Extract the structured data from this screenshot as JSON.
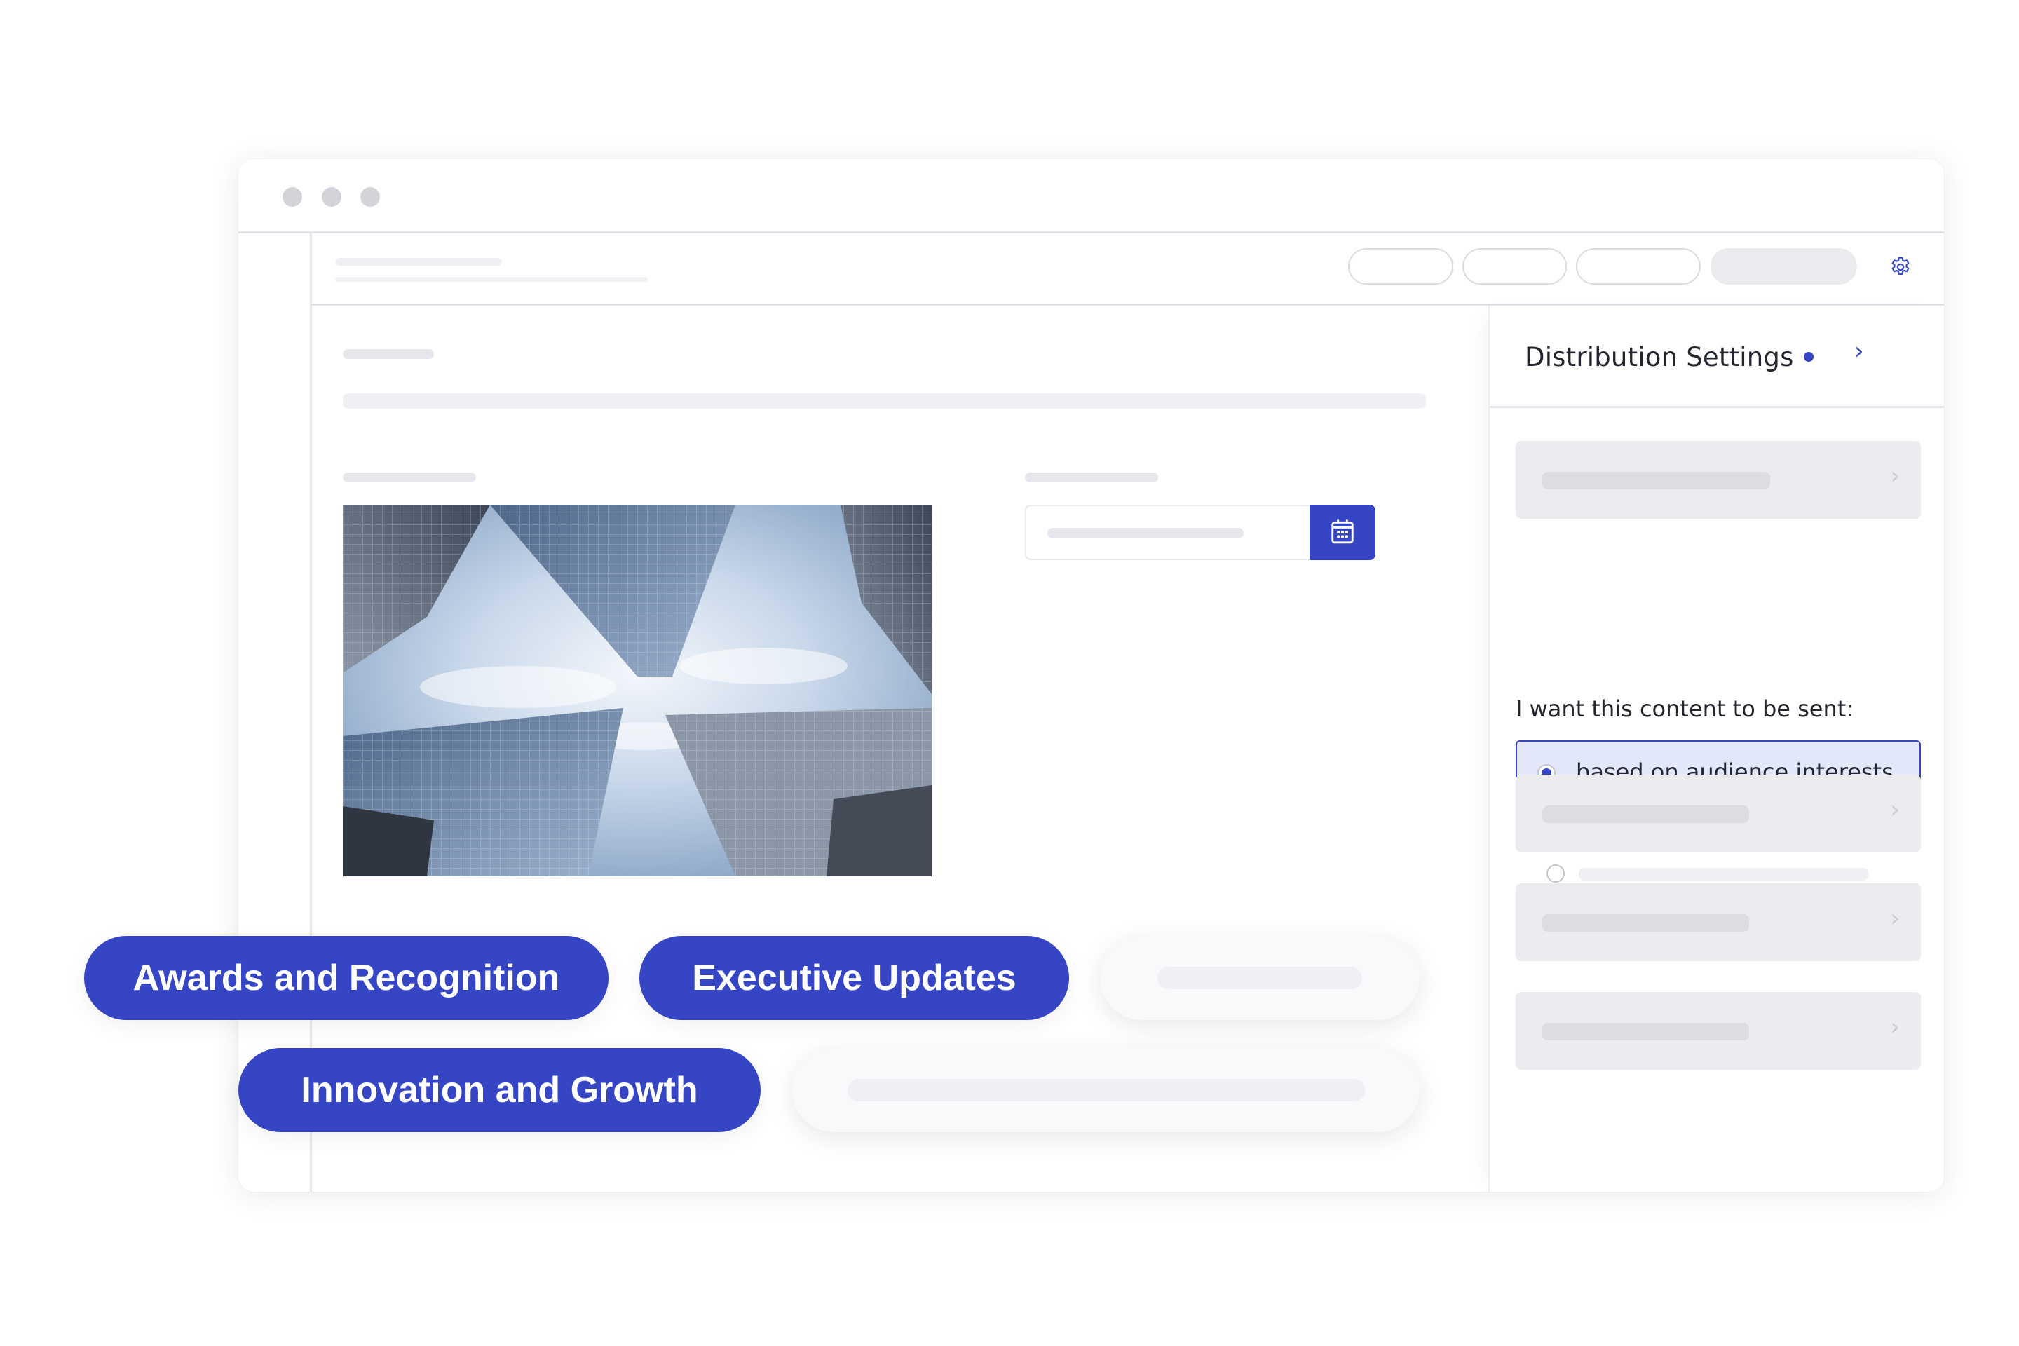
{
  "window": {
    "controls": [
      "window-dot",
      "window-dot",
      "window-dot"
    ]
  },
  "header": {
    "buttons": [
      {
        "label": "",
        "style": "outline"
      },
      {
        "label": "",
        "style": "outline"
      },
      {
        "label": "",
        "style": "outline"
      },
      {
        "label": "",
        "style": "filled"
      }
    ],
    "settings_icon": "gear-icon"
  },
  "panel": {
    "title": "Distribution Settings",
    "chevron": "›",
    "accordion_chevron": "›",
    "question": "I want this content to be sent:",
    "options": [
      {
        "label": "based on audience interests",
        "selected": true
      },
      {
        "label": "",
        "selected": false
      },
      {
        "label": "",
        "selected": false
      }
    ]
  },
  "main": {
    "date_button_icon": "calendar-icon"
  },
  "tags": [
    {
      "label": "Awards and Recognition",
      "active": true
    },
    {
      "label": "Executive Updates",
      "active": true
    },
    {
      "label": "",
      "active": false
    },
    {
      "label": "Innovation and Growth",
      "active": true
    },
    {
      "label": "",
      "active": false
    }
  ],
  "colors": {
    "accent": "#3545c4",
    "selected_bg": "#e2e7fa",
    "skeleton": "#efeff4",
    "accordion_bg": "#ebebf0"
  }
}
